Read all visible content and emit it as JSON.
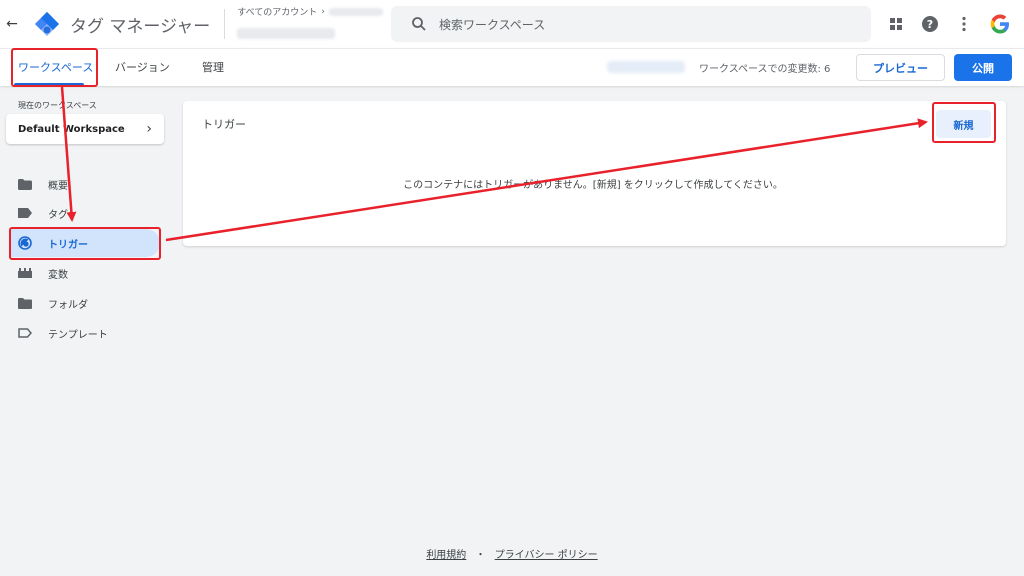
{
  "header": {
    "back_icon": "back-arrow-icon",
    "app_title": "タグ マネージャー",
    "account_label": "すべてのアカウント",
    "search_placeholder": "検索ワークスペース",
    "icons": [
      "apps-grid-icon",
      "help-icon",
      "more-vert-icon",
      "google-account-icon"
    ]
  },
  "subbar": {
    "tabs": [
      {
        "label": "ワークスペース",
        "active": true
      },
      {
        "label": "バージョン",
        "active": false
      },
      {
        "label": "管理",
        "active": false
      }
    ],
    "changes_label": "ワークスペースでの変更数: 6",
    "preview_label": "プレビュー",
    "publish_label": "公開"
  },
  "sidebar": {
    "current_ws_label": "現在のワークスペース",
    "workspace_name": "Default Workspace",
    "items": [
      {
        "label": "概要",
        "icon": "overview-folder-icon",
        "active": false
      },
      {
        "label": "タグ",
        "icon": "tag-icon",
        "active": false
      },
      {
        "label": "トリガー",
        "icon": "trigger-icon",
        "active": true
      },
      {
        "label": "変数",
        "icon": "variables-icon",
        "active": false
      },
      {
        "label": "フォルダ",
        "icon": "folder-icon",
        "active": false
      },
      {
        "label": "テンプレート",
        "icon": "template-icon",
        "active": false
      }
    ]
  },
  "main": {
    "card_title": "トリガー",
    "new_button": "新規",
    "empty_message": "このコンテナにはトリガーがありません。[新規] をクリックして作成してください。"
  },
  "footer": {
    "terms": "利用規約",
    "separator": "・",
    "privacy": "プライバシー ポリシー"
  },
  "colors": {
    "accent": "#1a73e8",
    "active_bg": "#d2e3fc",
    "annotation_red": "#e8212b",
    "page_bg": "#f1f3f4"
  }
}
